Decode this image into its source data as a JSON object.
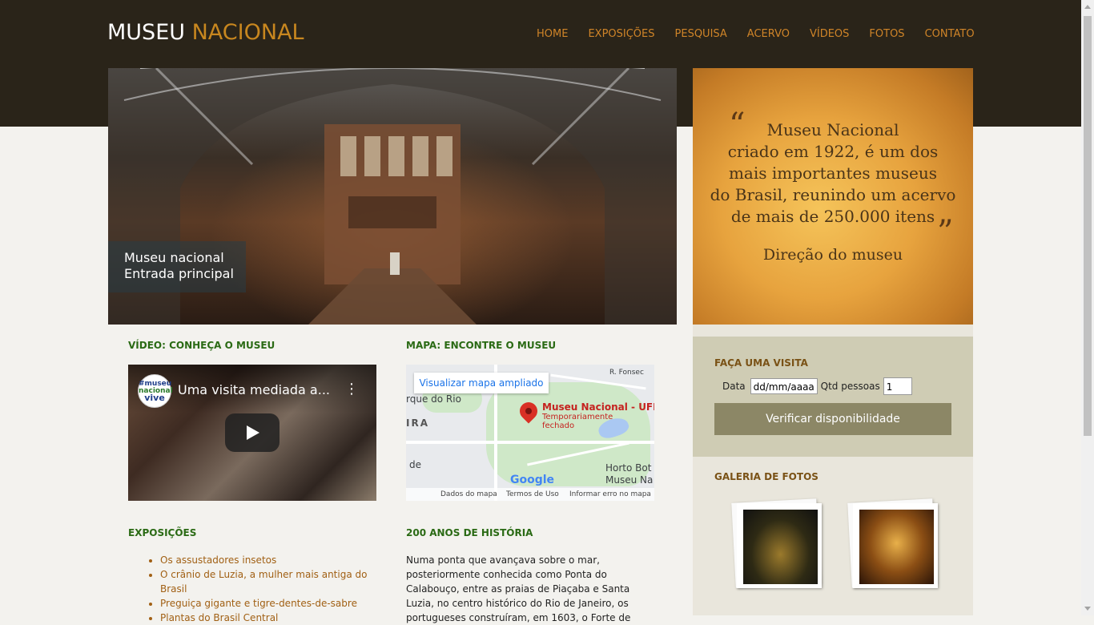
{
  "header": {
    "logo_part1": "MUSEU ",
    "logo_part2": "NACIONAL",
    "nav": [
      "HOME",
      "EXPOSIÇÕES",
      "PESQUISA",
      "ACERVO",
      "VÍDEOS",
      "FOTOS",
      "CONTATO"
    ]
  },
  "hero": {
    "caption_line1": "Museu nacional",
    "caption_line2": "Entrada principal"
  },
  "quote": {
    "open_mark": "“",
    "close_mark": "”",
    "lines": [
      "Museu Nacional",
      "criado em 1922, é um dos",
      "mais importantes museus",
      "do Brasil, reunindo um acervo",
      "de mais de 250.000 itens"
    ],
    "signature": "Direção do museu"
  },
  "visit": {
    "title": "FAÇA UMA VISITA",
    "date_label": "Data",
    "date_placeholder": "dd/mm/aaaa",
    "qty_label": "Qtd pessoas",
    "qty_value": "1",
    "button": "Verificar disponibilidade"
  },
  "gallery": {
    "title": "GALERIA DE FOTOS"
  },
  "video": {
    "section_title": "VÍDEO: CONHEÇA O MUSEU",
    "title": "Uma visita mediada a...",
    "channel_line1": "#museu",
    "channel_line2": "nacional",
    "channel_line3": "vive"
  },
  "map": {
    "section_title": "MAPA: ENCONTRE O MUSEU",
    "enlarge_button": "Visualizar mapa ampliado",
    "place_name": "Museu Nacional - UFRJ",
    "place_status_line1": "Temporariamente",
    "place_status_line2": "fechado",
    "label_parque": "rque do Rio",
    "label_ira": "IRA",
    "label_de": "de",
    "label_horto1": "Horto Bot",
    "label_horto2": "Museu Na",
    "label_fonsec": "R. Fonsec",
    "google": "Google",
    "footer": [
      "Dados do mapa",
      "Termos de Uso",
      "Informar erro no mapa"
    ]
  },
  "exposicoes": {
    "section_title": "EXPOSIÇÕES",
    "items": [
      "Os assustadores insetos",
      "O crânio de Luzia, a mulher mais antiga do Brasil",
      "Preguiça gigante e tigre-dentes-de-sabre",
      "Plantas do Brasil Central"
    ]
  },
  "historia": {
    "section_title": "200 ANOS DE HISTÓRIA",
    "text": "Numa ponta que avançava sobre o mar, posteriormente conhecida como Ponta do Calabouço, entre as praias de Piaçaba e Santa Luzia, no centro histórico do Rio de Janeiro, os portugueses construíram, em 1603, o Forte de"
  },
  "colors": {
    "header_bg": "#2a2419",
    "accent_orange": "#cf8428",
    "section_green": "#2a6a14",
    "visit_bg": "#cfccb4",
    "button_bg": "#8c8766"
  }
}
